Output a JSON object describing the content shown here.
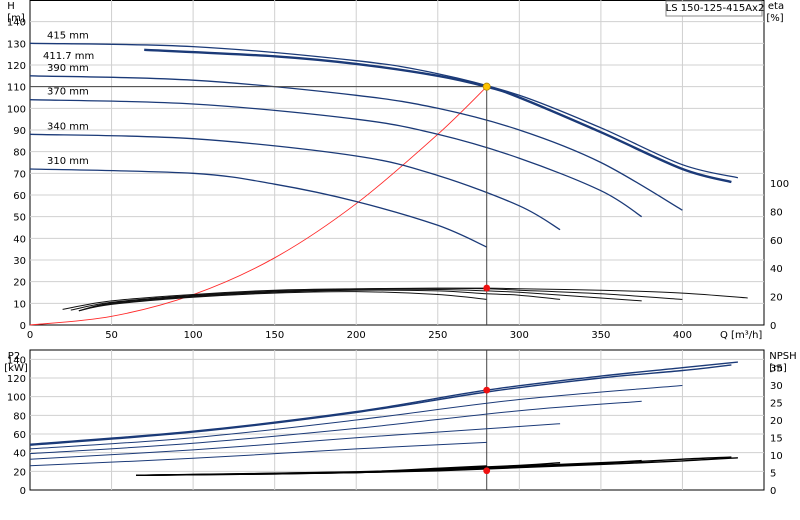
{
  "chart_data": [
    {
      "type": "line",
      "title": "LS 150-125-415Ax2",
      "ylabel": "H",
      "yunit": "[m]",
      "ylabel_right": "eta",
      "yunit_right": "[%]",
      "xlabel": "Q [m³/h]",
      "xlim": [
        0,
        450
      ],
      "ylim": [
        0,
        150
      ],
      "y2lim": [
        0,
        100
      ],
      "grid": true,
      "xticks": [
        0,
        50,
        100,
        150,
        200,
        250,
        300,
        350,
        400
      ],
      "yticks": [
        0,
        10,
        20,
        30,
        40,
        50,
        60,
        70,
        80,
        90,
        100,
        110,
        120,
        130,
        140
      ],
      "y2ticks": [
        0,
        20,
        40,
        60,
        80,
        100
      ],
      "head_curves": [
        {
          "name": "415 mm",
          "highlight": false,
          "points": [
            [
              0,
              130
            ],
            [
              100,
              128.5
            ],
            [
              200,
              122
            ],
            [
              250,
              116
            ],
            [
              300,
              106
            ],
            [
              350,
              91
            ],
            [
              400,
              74
            ],
            [
              434,
              68
            ]
          ]
        },
        {
          "name": "411.7 mm",
          "highlight": true,
          "points": [
            [
              70,
              127
            ],
            [
              150,
              124
            ],
            [
              200,
              120.5
            ],
            [
              250,
              115
            ],
            [
              280,
              110
            ],
            [
              300,
              105
            ],
            [
              350,
              89
            ],
            [
              400,
              72
            ],
            [
              430,
              66
            ]
          ]
        },
        {
          "name": "390 mm",
          "highlight": false,
          "points": [
            [
              0,
              115
            ],
            [
              100,
              113
            ],
            [
              200,
              106
            ],
            [
              250,
              100
            ],
            [
              300,
              90
            ],
            [
              350,
              75
            ],
            [
              400,
              53
            ]
          ]
        },
        {
          "name": "370 mm",
          "highlight": false,
          "points": [
            [
              0,
              104
            ],
            [
              100,
              102
            ],
            [
              200,
              95
            ],
            [
              250,
              88
            ],
            [
              300,
              77
            ],
            [
              350,
              62
            ],
            [
              375,
              50
            ]
          ]
        },
        {
          "name": "340 mm",
          "highlight": false,
          "points": [
            [
              0,
              88
            ],
            [
              100,
              86
            ],
            [
              200,
              78
            ],
            [
              250,
              69
            ],
            [
              300,
              55
            ],
            [
              325,
              44
            ]
          ]
        },
        {
          "name": "310 mm",
          "highlight": false,
          "points": [
            [
              0,
              72
            ],
            [
              100,
              70
            ],
            [
              150,
              65
            ],
            [
              200,
              57
            ],
            [
              250,
              46
            ],
            [
              280,
              36
            ]
          ]
        }
      ],
      "efficiency_curves": [
        {
          "points": [
            [
              20,
              11
            ],
            [
              50,
              17
            ],
            [
              100,
              21.5
            ],
            [
              150,
              24.5
            ],
            [
              200,
              25.5
            ],
            [
              250,
              26
            ],
            [
              280,
              26
            ],
            [
              300,
              25.5
            ],
            [
              350,
              24.5
            ],
            [
              400,
              22.5
            ],
            [
              440,
              19
            ]
          ]
        },
        {
          "points": [
            [
              25,
              10.5
            ],
            [
              50,
              16
            ],
            [
              100,
              21
            ],
            [
              150,
              24
            ],
            [
              200,
              25.3
            ],
            [
              250,
              25.8
            ],
            [
              280,
              25.5
            ],
            [
              300,
              24.5
            ],
            [
              350,
              22
            ],
            [
              400,
              18
            ]
          ]
        },
        {
          "points": [
            [
              30,
              10
            ],
            [
              50,
              15.5
            ],
            [
              100,
              20.5
            ],
            [
              150,
              23.5
            ],
            [
              200,
              25
            ],
            [
              250,
              25
            ],
            [
              280,
              24
            ],
            [
              300,
              23
            ],
            [
              350,
              19
            ],
            [
              375,
              17
            ]
          ]
        },
        {
          "points": [
            [
              30,
              10
            ],
            [
              50,
              15
            ],
            [
              100,
              20
            ],
            [
              150,
              23
            ],
            [
              200,
              24.5
            ],
            [
              250,
              24
            ],
            [
              280,
              22
            ],
            [
              300,
              21
            ],
            [
              325,
              18
            ]
          ]
        },
        {
          "points": [
            [
              30,
              10
            ],
            [
              50,
              14.5
            ],
            [
              100,
              19.5
            ],
            [
              150,
              22.5
            ],
            [
              200,
              23.5
            ],
            [
              250,
              21.5
            ],
            [
              280,
              18
            ]
          ]
        }
      ],
      "system_curve": {
        "points": [
          [
            0,
            0
          ],
          [
            50,
            4
          ],
          [
            100,
            14
          ],
          [
            150,
            31
          ],
          [
            200,
            56
          ],
          [
            250,
            88
          ],
          [
            280,
            110
          ]
        ]
      },
      "operating_point": {
        "q": 280,
        "h": 110,
        "eta": 26
      }
    },
    {
      "type": "line",
      "ylabel": "P2",
      "yunit": "[kW]",
      "ylabel_right": "NPSH",
      "yunit_right": "[m]",
      "xlim": [
        0,
        450
      ],
      "ylim": [
        0,
        150
      ],
      "y2lim": [
        0,
        40
      ],
      "grid": true,
      "yticks": [
        0,
        20,
        40,
        60,
        80,
        100,
        120,
        140
      ],
      "y2ticks": [
        0,
        5,
        10,
        15,
        20,
        25,
        30,
        35
      ],
      "power_curves": [
        {
          "points": [
            [
              0,
              49
            ],
            [
              100,
              63
            ],
            [
              200,
              84
            ],
            [
              280,
              107
            ],
            [
              350,
              122
            ],
            [
              400,
              131
            ],
            [
              434,
              137
            ]
          ]
        },
        {
          "points": [
            [
              0,
              48
            ],
            [
              100,
              62
            ],
            [
              200,
              83
            ],
            [
              280,
              105
            ],
            [
              350,
              120
            ],
            [
              400,
              128
            ],
            [
              430,
              134
            ]
          ]
        },
        {
          "points": [
            [
              0,
              44
            ],
            [
              100,
              56
            ],
            [
              200,
              75
            ],
            [
              300,
              97
            ],
            [
              400,
              112
            ]
          ]
        },
        {
          "points": [
            [
              0,
              39
            ],
            [
              100,
              50
            ],
            [
              200,
              66
            ],
            [
              300,
              85
            ],
            [
              375,
              95
            ]
          ]
        },
        {
          "points": [
            [
              0,
              33
            ],
            [
              100,
              43
            ],
            [
              200,
              56
            ],
            [
              300,
              68
            ],
            [
              325,
              71
            ]
          ]
        },
        {
          "points": [
            [
              0,
              26
            ],
            [
              100,
              34
            ],
            [
              200,
              44
            ],
            [
              280,
              51
            ]
          ]
        }
      ],
      "npsh_curves": [
        {
          "points": [
            [
              65,
              4.2
            ],
            [
              150,
              4.6
            ],
            [
              200,
              5
            ],
            [
              250,
              5.5
            ],
            [
              300,
              6.4
            ],
            [
              350,
              7.3
            ],
            [
              400,
              8.3
            ],
            [
              434,
              9.2
            ]
          ]
        },
        {
          "points": [
            [
              65,
              4.2
            ],
            [
              150,
              4.6
            ],
            [
              200,
              5
            ],
            [
              250,
              5.6
            ],
            [
              300,
              6.5
            ],
            [
              350,
              7.6
            ],
            [
              400,
              8.8
            ],
            [
              430,
              9.4
            ]
          ]
        },
        {
          "points": [
            [
              65,
              4.2
            ],
            [
              200,
              5
            ],
            [
              250,
              5.8
            ],
            [
              300,
              6.8
            ],
            [
              350,
              7.8
            ],
            [
              375,
              8.4
            ]
          ]
        },
        {
          "points": [
            [
              65,
              4.2
            ],
            [
              200,
              5.1
            ],
            [
              250,
              6
            ],
            [
              300,
              7
            ],
            [
              325,
              7.8
            ]
          ]
        },
        {
          "points": [
            [
              65,
              4.2
            ],
            [
              200,
              5.2
            ],
            [
              250,
              6.2
            ],
            [
              280,
              6.9
            ]
          ]
        }
      ],
      "operating_point": {
        "q": 280,
        "p2": 107,
        "npsh": 5.5
      }
    }
  ]
}
